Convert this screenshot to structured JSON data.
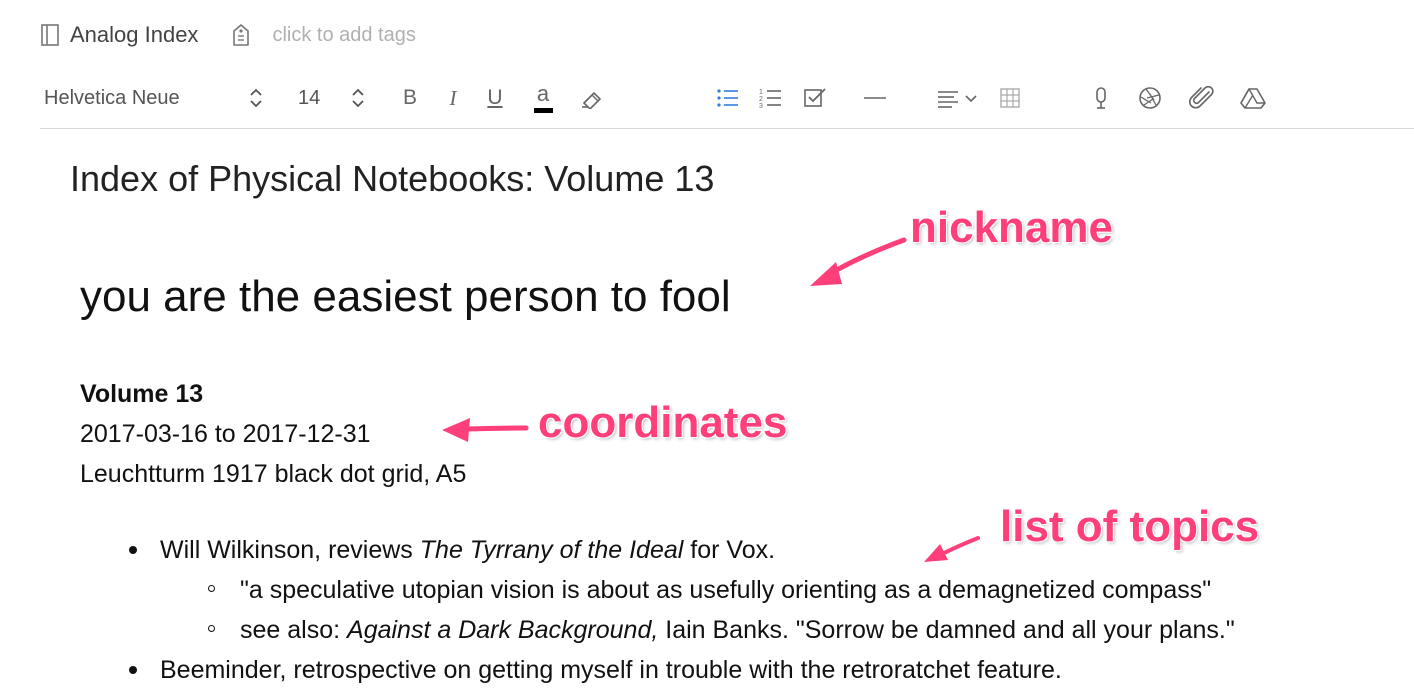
{
  "header": {
    "note_title": "Analog Index",
    "tags_placeholder": "click to add tags"
  },
  "toolbar": {
    "font_name": "Helvetica Neue",
    "font_size": "14",
    "bold": "B",
    "italic": "I",
    "underline": "U",
    "text_color": "a",
    "icons": [
      "stepper-icon",
      "bold-icon",
      "italic-icon",
      "underline-icon",
      "text-color-icon",
      "highlighter-icon",
      "bullet-list-icon",
      "numbered-list-icon",
      "checkbox-icon",
      "horizontal-rule-icon",
      "align-icon",
      "table-icon",
      "microphone-icon",
      "camera-aperture-icon",
      "attachment-icon",
      "google-drive-icon"
    ]
  },
  "editor": {
    "doc_title": "Index of Physical Notebooks: Volume 13",
    "heading": "you are the easiest person to fool",
    "volume_label": "Volume 13",
    "date_range": "2017-03-16 to 2017-12-31",
    "notebook_desc": "Leuchtturm 1917 black dot grid, A5",
    "list": [
      {
        "pre": "Will Wilkinson, reviews ",
        "em": "The Tyrrany of the Ideal",
        "post": " for Vox."
      },
      {
        "sub": "\"a speculative utopian vision is about as usefully orienting as a demagnetized compass\""
      },
      {
        "pre": "see also: ",
        "em": "Against a Dark Background,",
        "post": " Iain Banks. \"Sorrow be damned and all your plans.\""
      },
      {
        "text": "Beeminder, retrospective on getting myself in trouble with the retroratchet feature."
      }
    ]
  },
  "annotations": {
    "nickname": "nickname",
    "coordinates": "coordinates",
    "topics": "list of topics",
    "color": "#ff3f7a"
  }
}
